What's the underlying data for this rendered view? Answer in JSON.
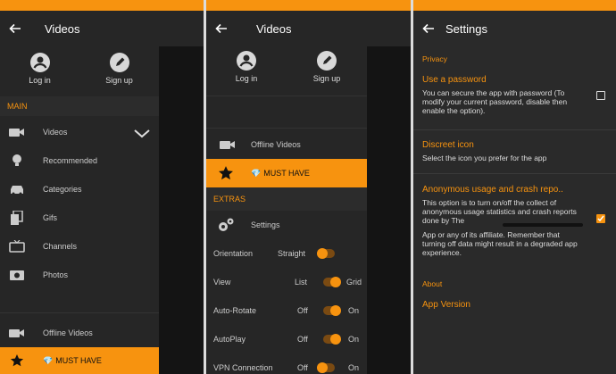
{
  "panel1": {
    "title": "Videos",
    "login": "Log in",
    "signup": "Sign up",
    "section_main": "MAIN",
    "items": [
      {
        "label": "Videos",
        "icon": "camera-icon"
      },
      {
        "label": "Recommended",
        "icon": "lightbulb-icon"
      },
      {
        "label": "Categories",
        "icon": "car-icon"
      },
      {
        "label": "Gifs",
        "icon": "gif-icon"
      },
      {
        "label": "Channels",
        "icon": "tv-icon"
      },
      {
        "label": "Photos",
        "icon": "photo-icon"
      }
    ],
    "offline": "Offline Videos",
    "must_have": "MUST HAVE"
  },
  "panel2": {
    "title": "Videos",
    "login": "Log in",
    "signup": "Sign up",
    "offline": "Offline Videos",
    "must_have": "MUST HAVE",
    "section_extras": "EXTRAS",
    "settings": "Settings",
    "rows": [
      {
        "label": "Orientation",
        "left": "",
        "right": "Straight",
        "state": "off"
      },
      {
        "label": "View",
        "left": "List",
        "right": "Grid",
        "state": "on"
      },
      {
        "label": "Auto-Rotate",
        "left": "Off",
        "right": "On",
        "state": "on"
      },
      {
        "label": "AutoPlay",
        "left": "Off",
        "right": "On",
        "state": "on"
      },
      {
        "label": "VPN Connection",
        "left": "Off",
        "right": "On",
        "state": "off"
      }
    ]
  },
  "panel3": {
    "title": "Settings",
    "privacy": "Privacy",
    "password_title": "Use a password",
    "password_desc": "You can secure the app with password (To modify your current password, disable then enable the option).",
    "discreet_title": "Discreet icon",
    "discreet_desc": "Select the icon you prefer for the app",
    "usage_title": "Anonymous usage and crash repo..",
    "usage_desc": "This option is to turn on/off the collect of anonymous usage statistics and crash reports done by The",
    "usage_desc2": "App or any of its affiliate. Remember that turning off data might result in a degraded app experience.",
    "about": "About",
    "app_version": "App Version"
  },
  "colors": {
    "accent": "#f7930f",
    "bg": "#262626",
    "gem": "#2fb5c9"
  }
}
